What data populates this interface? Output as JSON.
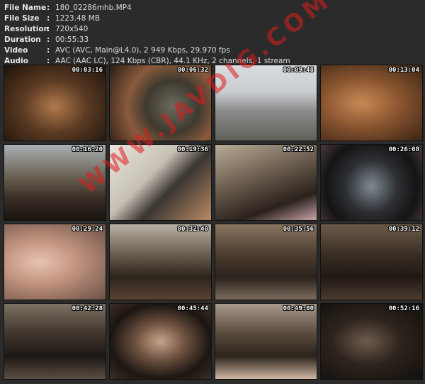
{
  "info": {
    "rows": [
      {
        "key": "File Name",
        "sep": ":",
        "value": "180_02286mhb.MP4"
      },
      {
        "key": "File Size",
        "sep": ":",
        "value": "1223.48 MB"
      },
      {
        "key": "Resolution",
        "sep": ":",
        "value": "720x540"
      },
      {
        "key": "Duration",
        "sep": ":",
        "value": "00:55:33"
      },
      {
        "key": "Video",
        "sep": ":",
        "value": "AVC (AVC, Main@L4.0), 2 949 Kbps, 29.970 fps"
      },
      {
        "key": "Audio",
        "sep": ":",
        "value": "AAC (AAC LC), 124 Kbps (CBR), 44.1 KHz, 2 channels, 1 stream"
      }
    ]
  },
  "thumbnails": [
    {
      "timestamp": "00:03:16"
    },
    {
      "timestamp": "00:06:32"
    },
    {
      "timestamp": "00:09:48"
    },
    {
      "timestamp": "00:13:04"
    },
    {
      "timestamp": "00:16:20"
    },
    {
      "timestamp": "00:19:36"
    },
    {
      "timestamp": "00:22:52"
    },
    {
      "timestamp": "00:26:08"
    },
    {
      "timestamp": "00:29:24"
    },
    {
      "timestamp": "00:32:40"
    },
    {
      "timestamp": "00:35:56"
    },
    {
      "timestamp": "00:39:12"
    },
    {
      "timestamp": "00:42:28"
    },
    {
      "timestamp": "00:45:44"
    },
    {
      "timestamp": "00:49:00"
    },
    {
      "timestamp": "00:52:16"
    }
  ],
  "watermark": "WWW.JAVDIG.COM"
}
